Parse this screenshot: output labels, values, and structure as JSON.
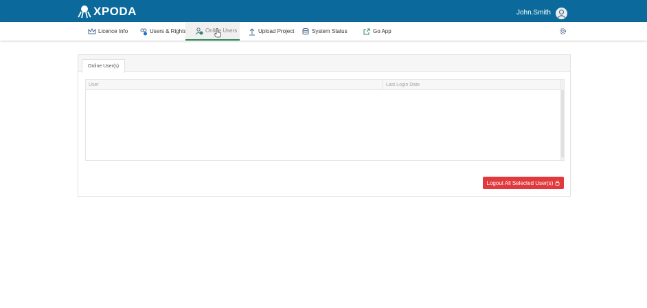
{
  "header": {
    "brand": "XPODA",
    "user_name": "John.Smith"
  },
  "nav": {
    "items": [
      {
        "label": "Licence Info",
        "icon": "crown-icon"
      },
      {
        "label": "Users & Rights",
        "icon": "users-rights-icon"
      },
      {
        "label": "Online Users",
        "icon": "online-users-icon"
      },
      {
        "label": "Upload Project",
        "icon": "upload-icon"
      },
      {
        "label": "System Status",
        "icon": "database-icon"
      },
      {
        "label": "Go App",
        "icon": "external-link-icon"
      }
    ],
    "active": "Online Users",
    "settings_icon": "gear-icon"
  },
  "panel": {
    "tab_label": "Online User(s)",
    "grid": {
      "columns": [
        "User",
        "Last Login Date"
      ],
      "rows": []
    },
    "logout_label": "Logout All Selected User(s)"
  },
  "colors": {
    "topbar": "#0b6a9b",
    "active_underline": "#2e8b57",
    "danger": "#e0393e"
  }
}
